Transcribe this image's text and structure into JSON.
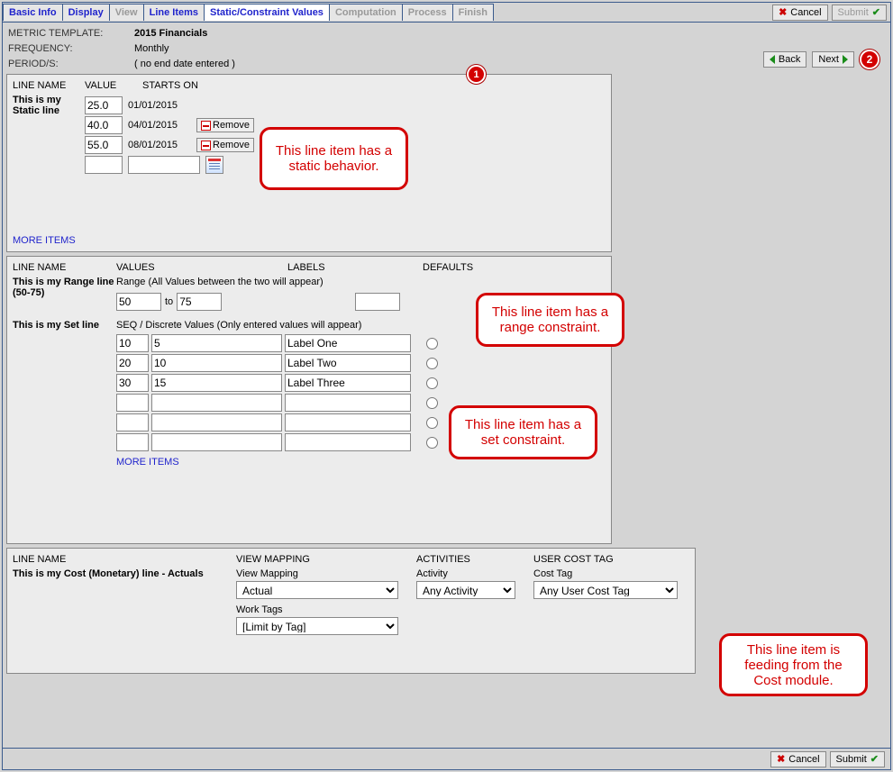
{
  "tabs": [
    "Basic Info",
    "Display",
    "View",
    "Line Items",
    "Static/Constraint Values",
    "Computation",
    "Process",
    "Finish"
  ],
  "active_tab": 4,
  "disabled_tabs": [
    2,
    5,
    6,
    7
  ],
  "top_buttons": {
    "cancel": "Cancel",
    "submit": "Submit"
  },
  "nav": {
    "back": "Back",
    "next": "Next",
    "step": "2"
  },
  "header": {
    "template_label": "METRIC TEMPLATE:",
    "template_value": "2015 Financials",
    "freq_label": "FREQUENCY:",
    "freq_value": "Monthly",
    "periods_label": "PERIOD/S:",
    "periods_value": "( no end date entered )"
  },
  "panel1": {
    "badge": "1",
    "cols": {
      "line": "LINE NAME",
      "value": "VALUE",
      "starts": "STARTS ON"
    },
    "line_name": "This is my Static line",
    "rows": [
      {
        "value": "25.0",
        "date": "01/01/2015",
        "removable": false
      },
      {
        "value": "40.0",
        "date": "04/01/2015",
        "removable": true
      },
      {
        "value": "55.0",
        "date": "08/01/2015",
        "removable": true
      },
      {
        "value": "",
        "date": "",
        "removable": false,
        "cal": true
      }
    ],
    "remove_label": "Remove",
    "more": "MORE ITEMS",
    "callout": "This line item has a static behavior."
  },
  "panel2": {
    "cols": {
      "line": "LINE NAME",
      "values": "VALUES",
      "labels": "LABELS",
      "defaults": "DEFAULTS"
    },
    "range_line_name": "This is my Range line (50-75)",
    "range_desc": "Range (All Values between the two will appear)",
    "range_from": "50",
    "to_label": "to",
    "range_to": "75",
    "range_default": "",
    "set_line_name": "This is my Set line",
    "set_desc": "SEQ / Discrete Values (Only entered values will appear)",
    "set_rows": [
      {
        "a": "10",
        "b": "5",
        "label": "Label One"
      },
      {
        "a": "20",
        "b": "10",
        "label": "Label Two"
      },
      {
        "a": "30",
        "b": "15",
        "label": "Label Three"
      },
      {
        "a": "",
        "b": "",
        "label": ""
      },
      {
        "a": "",
        "b": "",
        "label": ""
      },
      {
        "a": "",
        "b": "",
        "label": ""
      }
    ],
    "more": "MORE ITEMS",
    "callout_range": "This line item has a range constraint.",
    "callout_set": "This line item has a set constraint."
  },
  "panel3": {
    "cols": {
      "line": "LINE NAME",
      "view": "VIEW MAPPING",
      "act": "ACTIVITIES",
      "tag": "USER COST TAG"
    },
    "line_name": "This is my Cost (Monetary) line - Actuals",
    "view_lbl": "View Mapping",
    "view_val": "Actual",
    "tags_lbl": "Work Tags",
    "tags_val": "[Limit by Tag]",
    "act_lbl": "Activity",
    "act_val": "Any Activity",
    "cost_lbl": "Cost Tag",
    "cost_val": "Any User Cost Tag",
    "callout": "This line item is feeding from the Cost module."
  },
  "footer": {
    "cancel": "Cancel",
    "submit": "Submit"
  }
}
